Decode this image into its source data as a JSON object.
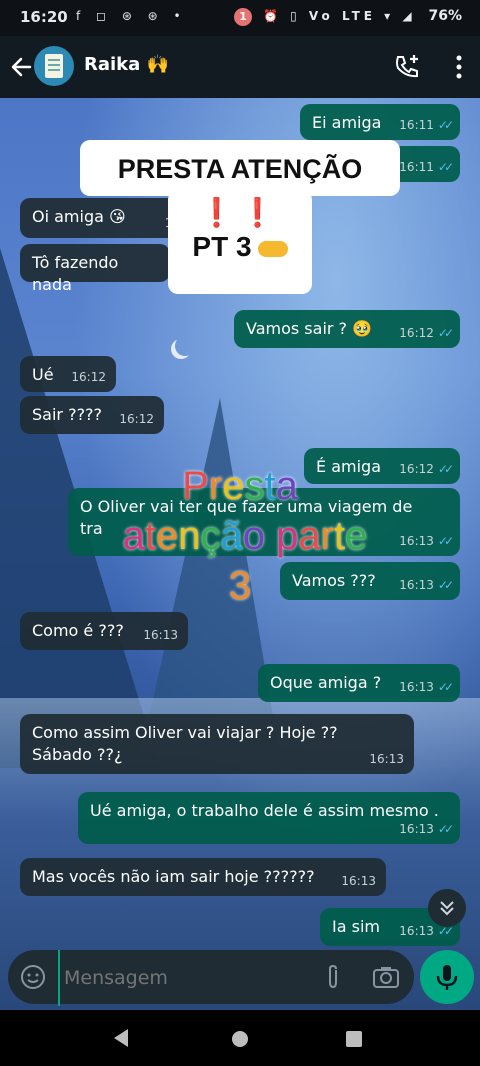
{
  "status_bar": {
    "time": "16:20",
    "left_icons": "f ◻ ⊛ ⊛ •",
    "notification_count": "1",
    "right_icons": "⏰ ▯ Vo LTE ▾ ◢",
    "battery": "76%"
  },
  "header": {
    "contact_name": "Raika 🙌",
    "icons": {
      "back": "arrow-left-icon",
      "add_call": "add-call-icon",
      "menu": "more-vert-icon"
    }
  },
  "messages": [
    {
      "dir": "out",
      "text": "Ei amiga",
      "time": "16:11",
      "ticks": "✓✓"
    },
    {
      "dir": "out",
      "text": "",
      "time": "16:11",
      "ticks": "✓✓"
    },
    {
      "dir": "in",
      "text": "Oi amiga 😘",
      "time": "16"
    },
    {
      "dir": "in",
      "text": "Tô fazendo nada",
      "time": ""
    },
    {
      "dir": "out",
      "text": "Vamos sair ? 🥹",
      "time": "16:12",
      "ticks": "✓✓"
    },
    {
      "dir": "in",
      "text": "Ué",
      "time": "16:12"
    },
    {
      "dir": "in",
      "text": "Sair ????",
      "time": "16:12"
    },
    {
      "dir": "out",
      "text": "É amiga",
      "time": "16:12",
      "ticks": "✓✓"
    },
    {
      "dir": "out",
      "text": "O Oliver vai ter que fazer uma viagem de\ntra",
      "time": "16:13",
      "ticks": "✓✓"
    },
    {
      "dir": "out",
      "text": "Vamos ???",
      "time": "16:13",
      "ticks": "✓✓"
    },
    {
      "dir": "in",
      "text": "Como é ???",
      "time": "16:13"
    },
    {
      "dir": "out",
      "text": "Oque amiga ?",
      "time": "16:13",
      "ticks": "✓✓"
    },
    {
      "dir": "in",
      "text": "Como assim Oliver vai viajar ? Hoje ??\nSábado ??¿",
      "time": "16:13"
    },
    {
      "dir": "out",
      "text": "Ué amiga, o trabalho dele é assim mesmo .",
      "time": "16:13",
      "ticks": "✓✓"
    },
    {
      "dir": "in",
      "text": "Mas vocês não iam sair hoje ??????",
      "time": "16:13"
    },
    {
      "dir": "out",
      "text": "Ia sim",
      "time": "16:13",
      "ticks": "✓✓"
    }
  ],
  "overlay": {
    "title": "PRESTA ATENÇÃO",
    "exclaim": "❗❗",
    "part": "PT 3",
    "rainbow_line1": [
      "P",
      "r",
      "e",
      "s",
      "t",
      "a"
    ],
    "rainbow_line2": [
      "a",
      "t",
      "e",
      "n",
      "ç",
      "ã",
      "o",
      " ",
      "p",
      "a",
      "r",
      "t",
      "e"
    ],
    "rainbow_line3": [
      "3"
    ]
  },
  "input": {
    "placeholder": "Mensagem"
  },
  "icons": {
    "emoji": "sticker-icon",
    "attach": "paperclip-icon",
    "camera": "camera-icon",
    "mic": "mic-icon",
    "scroll_down": "double-chevron-down-icon"
  },
  "colors": {
    "outgoing_bubble": "#005c4b",
    "incoming_bubble": "#1f2c34",
    "read_ticks": "#53bdeb",
    "accent": "#00a884"
  }
}
